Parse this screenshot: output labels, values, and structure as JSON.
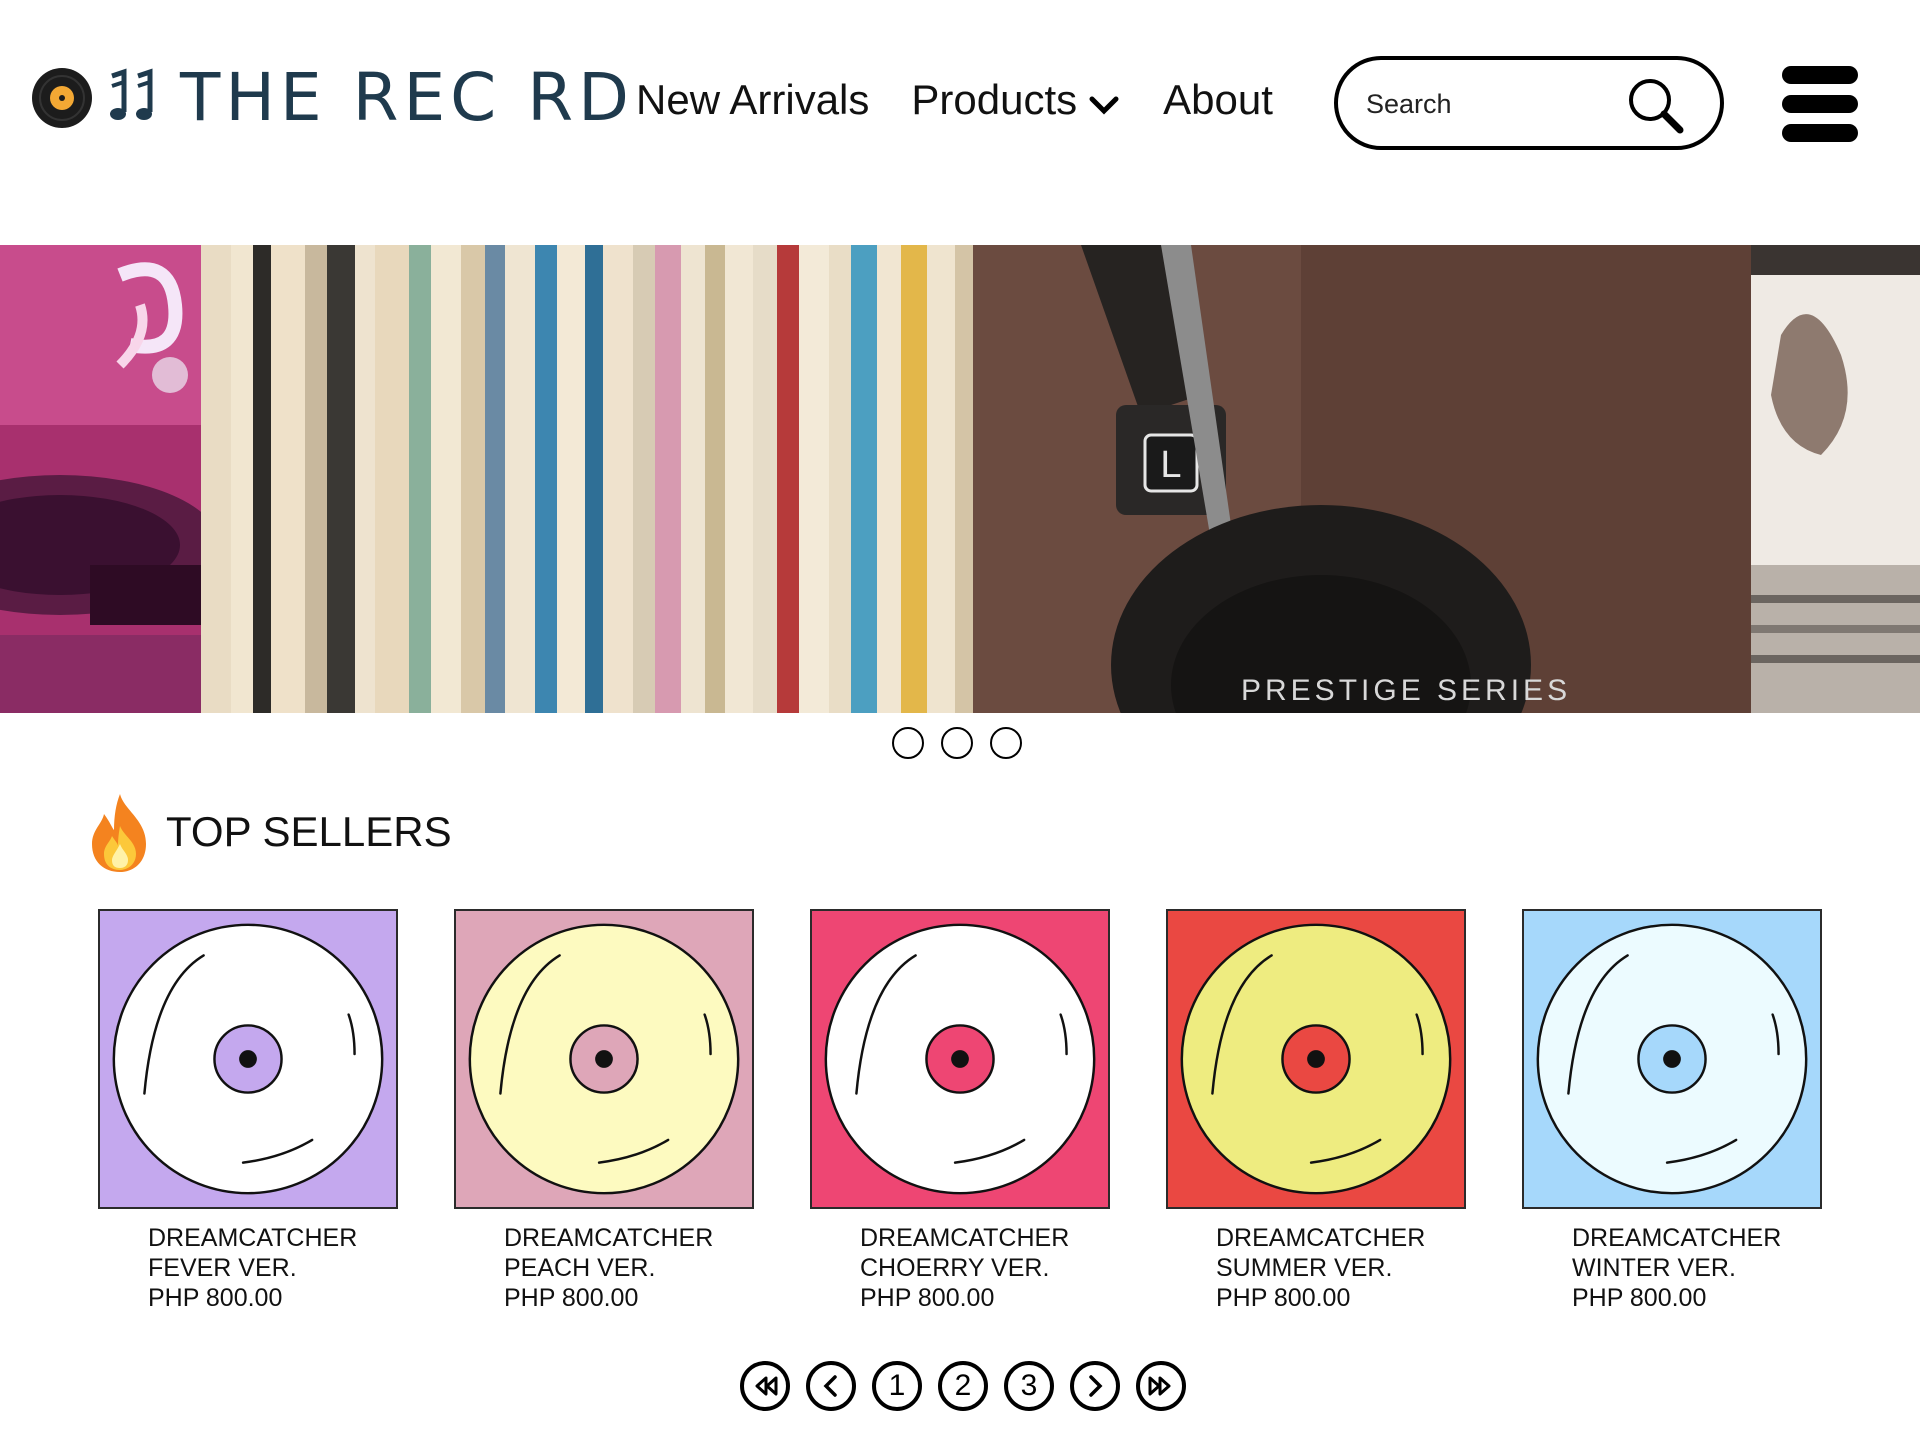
{
  "brand": {
    "name": "OFF THE RECORD",
    "logo_text": "THE REC RD"
  },
  "nav": {
    "new_arrivals": "New Arrivals",
    "products": "Products",
    "about": "About"
  },
  "search": {
    "placeholder": "Search",
    "value": ""
  },
  "carousel": {
    "slide_count": 3,
    "headphone_label": "L",
    "headphone_text": "PRESTIGE SERIES"
  },
  "top_sellers": {
    "title": "TOP SELLERS",
    "products": [
      {
        "artist": "DREAMCATCHER",
        "version": "FEVER VER.",
        "price": "PHP 800.00",
        "bg": "#c4a8ee",
        "disc": "#ffffff",
        "label": "#c4a8ee"
      },
      {
        "artist": "DREAMCATCHER",
        "version": "PEACH VER.",
        "price": "PHP 800.00",
        "bg": "#dea6b8",
        "disc": "#fdfac0",
        "label": "#dea6b8"
      },
      {
        "artist": "DREAMCATCHER",
        "version": "CHOERRY VER.",
        "price": "PHP 800.00",
        "bg": "#ee4673",
        "disc": "#ffffff",
        "label": "#ee4673"
      },
      {
        "artist": "DREAMCATCHER",
        "version": "SUMMER VER.",
        "price": "PHP 800.00",
        "bg": "#ea4842",
        "disc": "#eeec80",
        "label": "#ea4842"
      },
      {
        "artist": "DREAMCATCHER",
        "version": "WINTER VER.",
        "price": "PHP 800.00",
        "bg": "#a6d8fb",
        "disc": "#ecfbff",
        "label": "#a6d8fb"
      }
    ]
  },
  "pagination": {
    "pages": [
      "1",
      "2",
      "3"
    ]
  }
}
